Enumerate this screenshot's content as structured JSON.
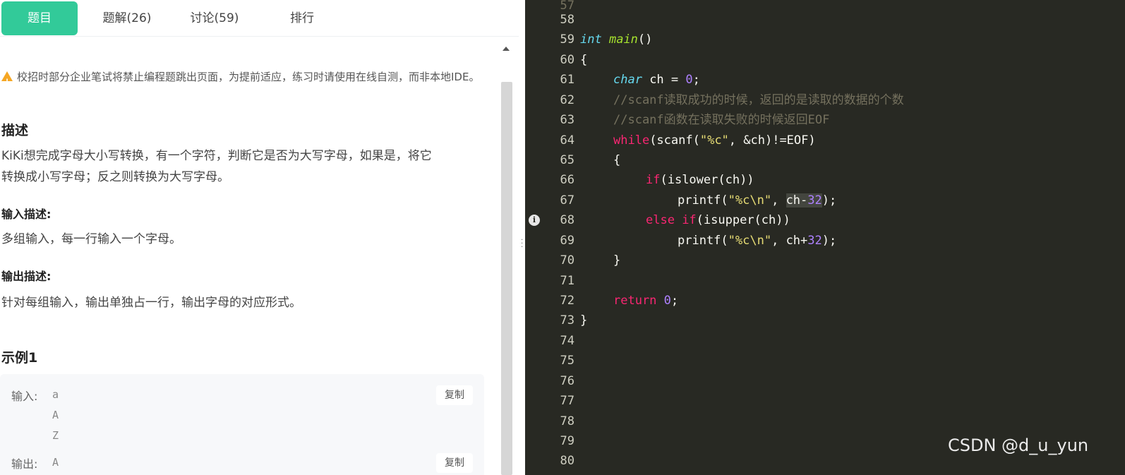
{
  "tabs": [
    {
      "label": "题目"
    },
    {
      "label": "题解(26)"
    },
    {
      "label": "讨论(59)"
    },
    {
      "label": "排行"
    }
  ],
  "problem": {
    "notice": "校招时部分企业笔试将禁止编程题跳出页面，为提前适应，练习时请使用在线自测，而非本地IDE。",
    "desc_title": "描述",
    "desc_line1": "KiKi想完成字母大小写转换，有一个字符，判断它是否为大写字母，如果是，将它",
    "desc_line2": "转换成小写字母；反之则转换为大写字母。",
    "input_title": "输入描述:",
    "input_text": "多组输入，每一行输入一个字母。",
    "output_title": "输出描述:",
    "output_text": "针对每组输入，输出单独占一行，输出字母的对应形式。",
    "example_title": "示例1",
    "example": {
      "input_label": "输入:",
      "input_values": [
        "a",
        "A",
        "Z"
      ],
      "output_label": "输出:",
      "output_values": [
        "A"
      ],
      "copy_label": "复制"
    }
  },
  "editor": {
    "lines": [
      {
        "n": "58"
      },
      {
        "n": "59"
      },
      {
        "n": "60"
      },
      {
        "n": "61"
      },
      {
        "n": "62"
      },
      {
        "n": "63"
      },
      {
        "n": "64"
      },
      {
        "n": "65"
      },
      {
        "n": "66"
      },
      {
        "n": "67"
      },
      {
        "n": "68"
      },
      {
        "n": "69"
      },
      {
        "n": "70"
      },
      {
        "n": "71"
      },
      {
        "n": "72"
      },
      {
        "n": "73"
      },
      {
        "n": "74"
      },
      {
        "n": "75"
      },
      {
        "n": "76"
      },
      {
        "n": "77"
      },
      {
        "n": "78"
      },
      {
        "n": "79"
      },
      {
        "n": "80"
      }
    ],
    "tokens": {
      "int": "int",
      "main": "main",
      "parens": "()",
      "brace_open": "{",
      "brace_close": "}",
      "char": "char",
      "ch_decl": " ch = ",
      "zero": "0",
      "semicolon": ";",
      "comment1": "//scanf读取成功的时候，返回的是读取的数据的个数",
      "comment2": "//scanf函数在读取失败的时候返回EOF",
      "while": "while",
      "scanf_open": "(scanf(",
      "fmt_c": "\"%c\"",
      "scanf_rest": ", &ch)!=EOF)",
      "if": "if",
      "islower": "(islower(ch))",
      "printf_open": "printf(",
      "fmt_cn": "\"%c\\n\"",
      "comma": ", ",
      "ch_minus": "ch-",
      "thirty_two": "32",
      "close_semi": ");",
      "else": "else",
      "space_if": " if",
      "isupper": "(isupper(ch))",
      "ch_plus": "ch+",
      "return": "return",
      "space": " "
    },
    "info_glyph": "i"
  },
  "watermark": "CSDN @d_u_yun"
}
